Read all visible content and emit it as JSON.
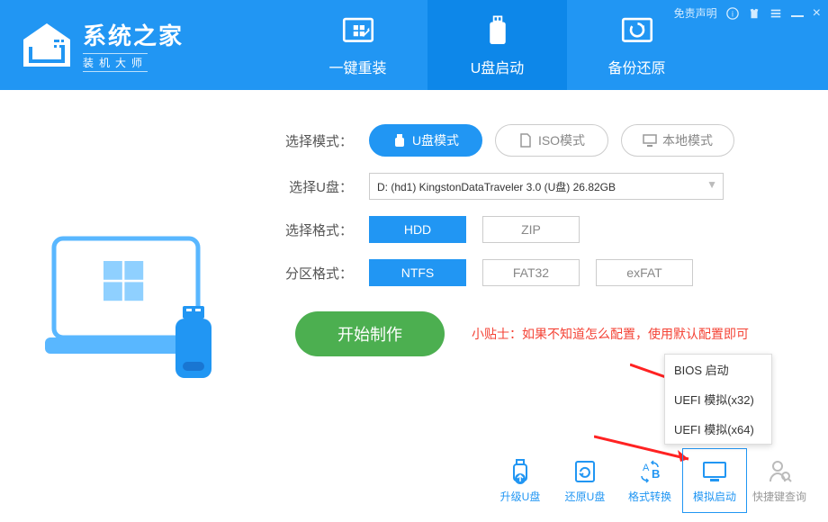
{
  "header": {
    "logo_title": "系统之家",
    "logo_subtitle": "装机大师",
    "disclaimer": "免责声明",
    "nav": [
      {
        "label": "一键重装"
      },
      {
        "label": "U盘启动"
      },
      {
        "label": "备份还原"
      }
    ]
  },
  "mode": {
    "label": "选择模式：",
    "options": [
      {
        "label": "U盘模式",
        "active": true
      },
      {
        "label": "ISO模式",
        "active": false
      },
      {
        "label": "本地模式",
        "active": false
      }
    ]
  },
  "usb": {
    "label": "选择U盘：",
    "value": "D: (hd1) KingstonDataTraveler 3.0 (U盘) 26.82GB"
  },
  "fmt": {
    "label": "选择格式：",
    "options": [
      {
        "label": "HDD",
        "active": true
      },
      {
        "label": "ZIP",
        "active": false
      }
    ]
  },
  "part": {
    "label": "分区格式：",
    "options": [
      {
        "label": "NTFS",
        "active": true
      },
      {
        "label": "FAT32",
        "active": false
      },
      {
        "label": "exFAT",
        "active": false
      }
    ]
  },
  "start_label": "开始制作",
  "tip": "小贴士：如果不知道怎么配置，使用默认配置即可",
  "popup": {
    "items": [
      "BIOS 启动",
      "UEFI 模拟(x32)",
      "UEFI 模拟(x64)"
    ]
  },
  "tools": [
    {
      "label": "升级U盘"
    },
    {
      "label": "还原U盘"
    },
    {
      "label": "格式转换"
    },
    {
      "label": "模拟启动"
    },
    {
      "label": "快捷键查询"
    }
  ]
}
